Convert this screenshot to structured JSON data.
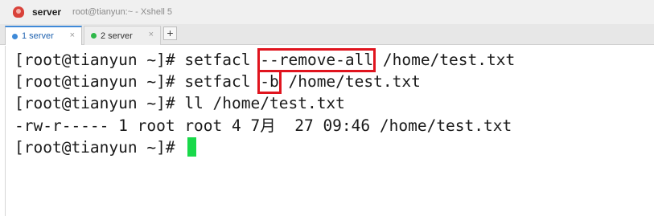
{
  "window": {
    "title": "server",
    "subtitle": "root@tianyun:~ - Xshell 5"
  },
  "tabs": [
    {
      "label": "1 server",
      "close": "×",
      "active": true,
      "dot_color": "#3f8ad8"
    },
    {
      "label": "2 server",
      "close": "×",
      "active": false,
      "dot_color": "#2fb84a"
    }
  ],
  "add_tab": "+",
  "terminal": {
    "line1": {
      "prompt": "[root@tianyun ~]# ",
      "cmd": "setfacl ",
      "flag": "--remove-all",
      "rest": " /home/test.txt"
    },
    "line2": {
      "prompt": "[root@tianyun ~]# ",
      "cmd": "setfacl ",
      "flag": "-b",
      "rest": " /home/test.txt"
    },
    "line3": {
      "prompt": "[root@tianyun ~]# ",
      "cmd": "ll /home/test.txt"
    },
    "line4": {
      "output": "-rw-r----- 1 root root 4 7月  27 09:46 /home/test.txt"
    },
    "line5": {
      "prompt": "[root@tianyun ~]# "
    }
  },
  "colors": {
    "highlight_box": "#e0141e",
    "cursor": "#19d94a",
    "active_tab_accent": "#3f8ad8"
  },
  "icons": {
    "app": "xshell-icon"
  }
}
